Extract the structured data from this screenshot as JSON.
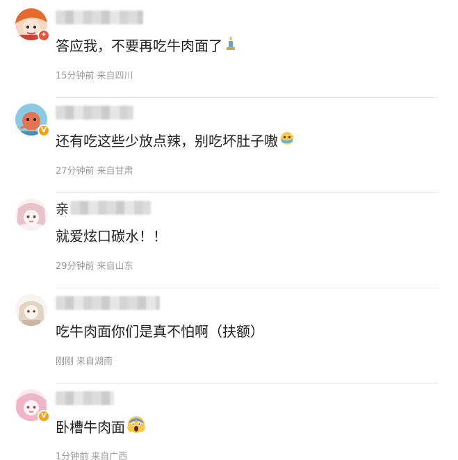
{
  "comments": [
    {
      "name_prefix": "",
      "text": "答应我，不要再吃牛肉面了",
      "emoji": "candle-emoji",
      "time": "15分钟前",
      "location": "来自四川",
      "badge": "red",
      "avatar_color": "#e7804a"
    },
    {
      "name_prefix": "",
      "text": "还有吃这些少放点辣，别吃坏肚子嗷",
      "emoji": "crying-face-emoji",
      "time": "27分钟前",
      "location": "来自甘肃",
      "badge": "gold",
      "avatar_color": "#5fa7c8"
    },
    {
      "name_prefix": "亲",
      "text": "就爱炫口碳水！！",
      "emoji": "",
      "time": "29分钟前",
      "location": "来自山东",
      "badge": "",
      "avatar_color": "#e9c9cf"
    },
    {
      "name_prefix": "",
      "text": "吃牛肉面你们是真不怕啊（扶额）",
      "emoji": "",
      "time": "刚刚",
      "location": "来自湖南",
      "badge": "",
      "avatar_color": "#d9cfc4"
    },
    {
      "name_prefix": "",
      "text": "卧槽牛肉面",
      "emoji": "screaming-face-emoji",
      "time": "1分钟前",
      "location": "来自广西",
      "badge": "gold",
      "avatar_color": "#f0c6d3"
    }
  ]
}
